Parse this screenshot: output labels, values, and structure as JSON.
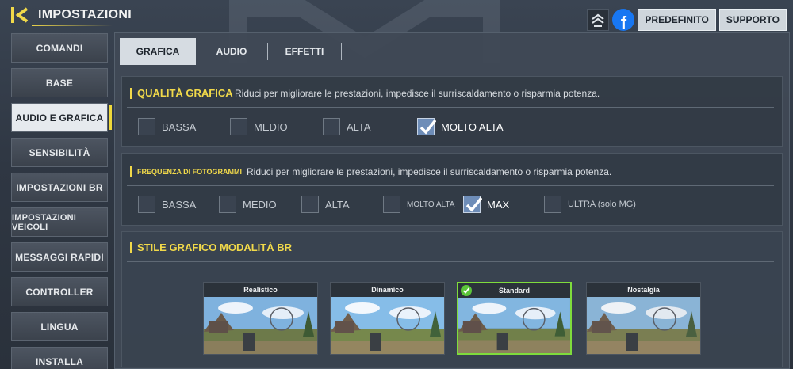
{
  "header": {
    "title": "IMPOSTAZIONI",
    "buttons": {
      "default": "PREDEFINITO",
      "support": "SUPPORTO"
    }
  },
  "icons": {
    "back": "back-arrow-icon",
    "rank": "rank-chevron-icon",
    "facebook": "facebook-icon",
    "check": "check-icon"
  },
  "colors": {
    "accent": "#f1d94a",
    "selected_border": "#7fdc3c",
    "facebook": "#1877f2",
    "checkbox_checked": "#6e8db8"
  },
  "sidebar": {
    "items": [
      {
        "label": "COMANDI"
      },
      {
        "label": "BASE"
      },
      {
        "label": "AUDIO E GRAFICA",
        "active": true
      },
      {
        "label": "SENSIBILITÀ"
      },
      {
        "label": "IMPOSTAZIONI BR"
      },
      {
        "label": "IMPOSTAZIONI VEICOLI"
      },
      {
        "label": "MESSAGGI RAPIDI"
      },
      {
        "label": "CONTROLLER"
      },
      {
        "label": "LINGUA"
      },
      {
        "label": "INSTALLA"
      }
    ]
  },
  "tabs": [
    {
      "label": "GRAFICA",
      "active": true
    },
    {
      "label": "AUDIO"
    },
    {
      "label": "EFFETTI"
    }
  ],
  "quality": {
    "title": "QUALITÀ GRAFICA",
    "description": "Riduci per migliorare le prestazioni, impedisce il surriscaldamento o risparmia potenza.",
    "options": [
      "BASSA",
      "MEDIO",
      "ALTA",
      "MOLTO ALTA"
    ],
    "selected": "MOLTO ALTA"
  },
  "framerate": {
    "title": "FREQUENZA DI FOTOGRAMMI",
    "description": "Riduci per migliorare le prestazioni, impedisce il surriscaldamento o risparmia potenza.",
    "options": [
      "BASSA",
      "MEDIO",
      "ALTA",
      "MOLTO ALTA",
      "MAX",
      "ULTRA (solo MG)"
    ],
    "selected": "MAX"
  },
  "style": {
    "title": "STILE GRAFICO MODALITÀ BR",
    "options": [
      "Realistico",
      "Dinamico",
      "Standard",
      "Nostalgia"
    ],
    "selected": "Standard"
  }
}
